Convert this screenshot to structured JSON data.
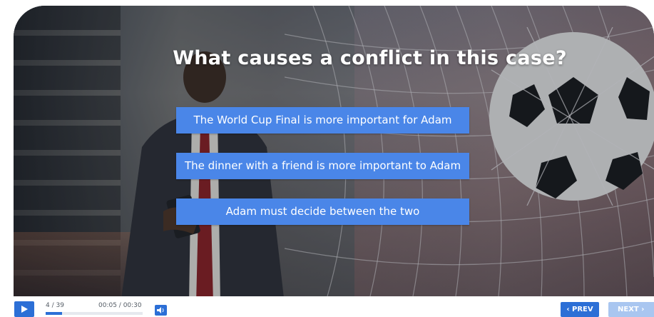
{
  "slide": {
    "question": "What causes a conflict in this case?",
    "answers": [
      "The World Cup Final is more important for Adam",
      "The dinner with a friend is more important to Adam",
      "Adam must decide between the two"
    ],
    "answer_color": "#4a86e8"
  },
  "player": {
    "slide_counter": "4 / 39",
    "time": "00:05 / 00:30",
    "progress": 0.17,
    "accent": "#2c6fd6",
    "prev_label": "‹ PREV",
    "next_label": "NEXT ›",
    "icons": [
      "play-icon",
      "volume-icon"
    ]
  }
}
